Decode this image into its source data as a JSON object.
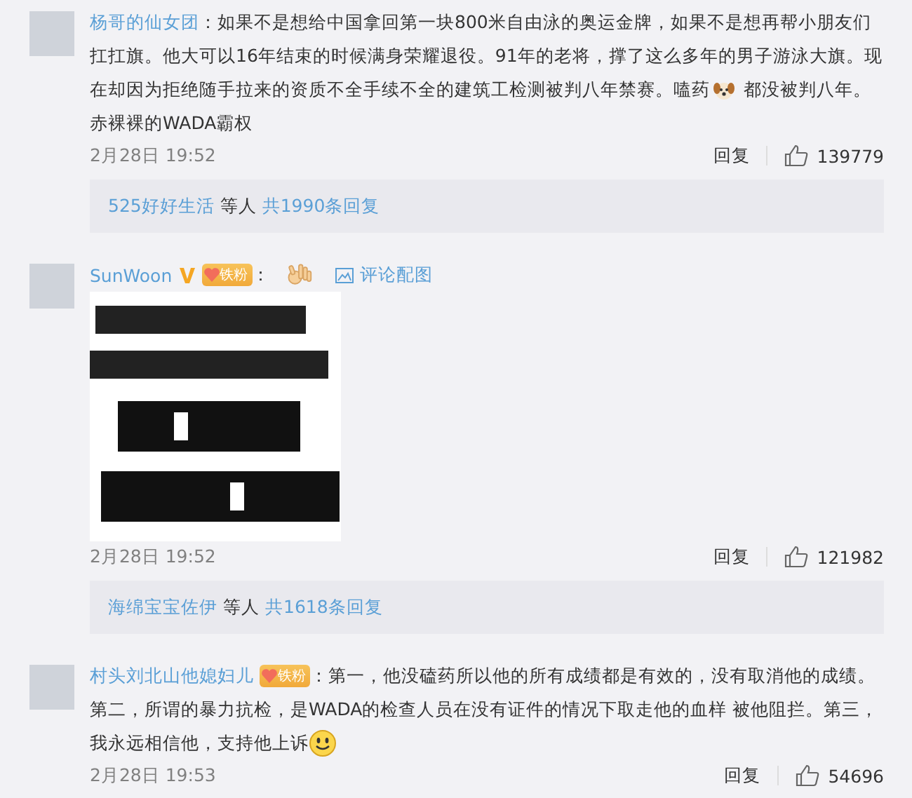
{
  "comments": [
    {
      "author": "杨哥的仙女团",
      "colon": "：",
      "lines": [
        [
          {
            "kind": "text",
            "text": "如果不是想给中国拿回第一块800米自由泳的奥运金牌，如果不是想再帮小朋友们"
          }
        ],
        [
          {
            "kind": "text",
            "text": "扛扛旗。他大可以16年结束的时候满身荣耀退役。91年的老将，撑了这么多年的男子游泳大旗。现"
          }
        ],
        [
          {
            "kind": "text",
            "text": "在却因为拒绝随手拉来的资质不全手续不全的建筑工检测被判八年禁赛。嗑药"
          },
          {
            "kind": "dog"
          },
          {
            "kind": "text",
            "text": "都没被判八年。"
          }
        ],
        [
          {
            "kind": "text",
            "text": "赤裸裸的WADA霸权"
          }
        ]
      ],
      "time": "2月28日 19:52",
      "reply": "回复",
      "likes": "139779",
      "replies": {
        "user": "525好好生活",
        "others": "等人",
        "total": "共1990条回复"
      }
    },
    {
      "author": "SunWoon",
      "badges": [
        {
          "kind": "verified"
        },
        {
          "kind": "fan",
          "label": "铁粉"
        }
      ],
      "colon": "：",
      "lines": [
        [
          {
            "kind": "ok"
          }
        ]
      ],
      "image_link": "评论配图",
      "picture": {
        "kind": "picture"
      },
      "time": "2月28日 19:52",
      "reply": "回复",
      "likes": "121982",
      "replies": {
        "user": "海绵宝宝佐伊",
        "others": "等人",
        "total": "共1618条回复"
      }
    },
    {
      "author": "村头刘北山他媳妇儿",
      "badges": [
        {
          "kind": "fan",
          "label": "铁粉"
        }
      ],
      "colon": "：",
      "lines": [
        [
          {
            "kind": "text",
            "text": "第一，他没磕药所以他的所有成绩都是有效的，没有取消他的成绩。"
          }
        ],
        [
          {
            "kind": "text",
            "text": "第二，所谓的暴力抗检，是WADA的检查人员在没有证件的情况下取走他的血样 被他阻拦。第三，"
          }
        ],
        [
          {
            "kind": "text",
            "text": "我永远相信他，支持他上诉"
          },
          {
            "kind": "smile"
          }
        ]
      ],
      "time": "2月28日 19:53",
      "reply": "回复",
      "likes": "54696"
    }
  ]
}
